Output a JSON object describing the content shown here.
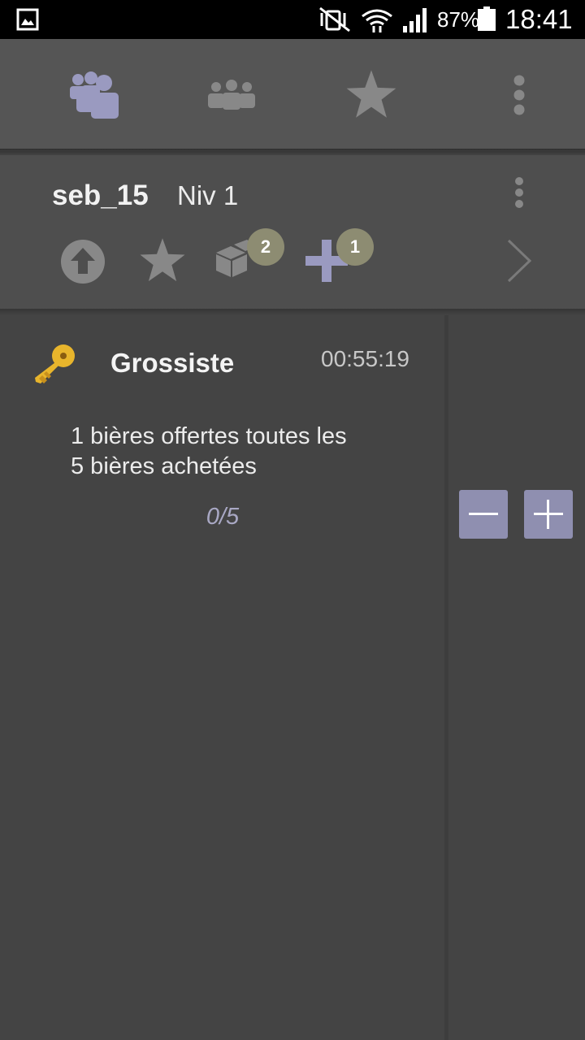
{
  "status_bar": {
    "battery_percent": "87%",
    "time": "18:41",
    "icons": [
      "gallery-icon",
      "vibrate-mute-icon",
      "wifi-icon",
      "signal-icon",
      "battery-icon"
    ]
  },
  "top_nav": {
    "tabs": [
      {
        "icon": "users-icon",
        "active": true
      },
      {
        "icon": "groups-icon",
        "active": false
      },
      {
        "icon": "star-icon",
        "active": false
      }
    ],
    "overflow_icon": "more-vert-icon"
  },
  "profile": {
    "username": "seb_15",
    "level": "Niv 1",
    "actions": [
      {
        "icon": "upload-circle-icon"
      },
      {
        "icon": "star-icon"
      },
      {
        "icon": "box-icon",
        "badge": "2"
      },
      {
        "icon": "plus-icon",
        "badge": "1"
      }
    ],
    "next_icon": "chevron-right-icon"
  },
  "reward_card": {
    "icon": "key-icon",
    "title": "Grossiste",
    "timer": "00:55:19",
    "description_line1": "1 bières offertes toutes les",
    "description_line2": "5 bières achetées",
    "progress_text": "0/5",
    "progress": {
      "current": 0,
      "total": 5
    }
  },
  "stepper": {
    "decrement_icon": "minus-icon",
    "increment_icon": "plus-icon"
  },
  "colors": {
    "background": "#444444",
    "nav_bar": "#555555",
    "accent": "#8f8fb0",
    "badge": "#8d8c72"
  }
}
